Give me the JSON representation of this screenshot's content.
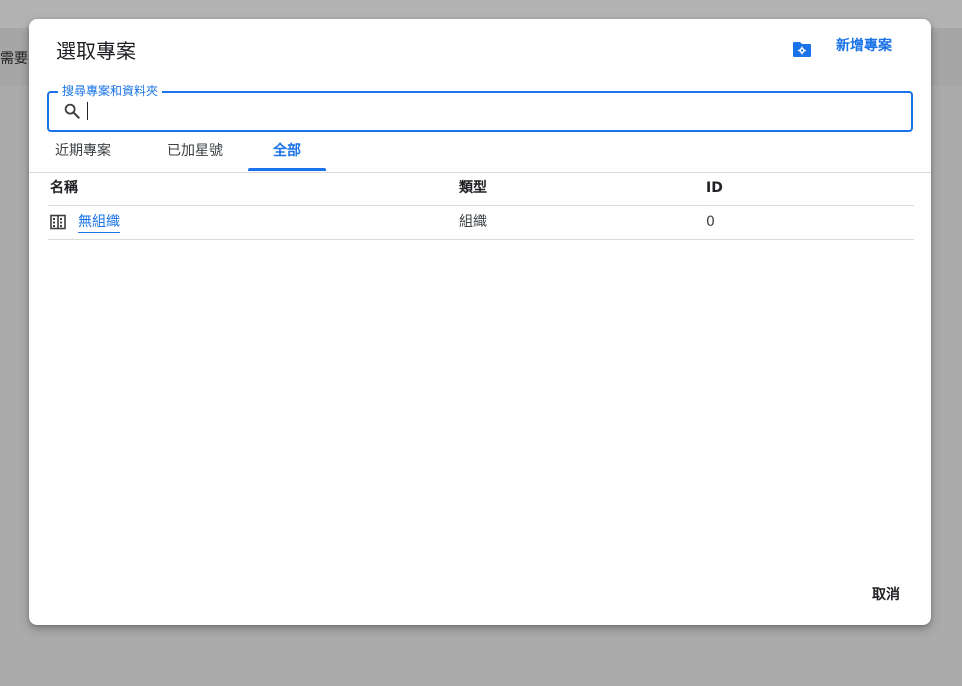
{
  "background": {
    "snippet_text": "需要查"
  },
  "dialog": {
    "title": "選取專案",
    "new_folder_icon": "folder-settings-icon",
    "new_project_label": "新增專案",
    "search": {
      "label": "搜尋專案和資料夾",
      "value": "",
      "icon": "search-icon"
    },
    "tabs": [
      {
        "label": "近期專案",
        "active": false
      },
      {
        "label": "已加星號",
        "active": false
      },
      {
        "label": "全部",
        "active": true
      }
    ],
    "table": {
      "headers": {
        "name": "名稱",
        "type": "類型",
        "id": "ID"
      },
      "rows": [
        {
          "name": "無組織",
          "type": "組織",
          "id": "0",
          "icon": "organization-icon"
        }
      ]
    },
    "cancel_label": "取消"
  },
  "colors": {
    "accent": "#1a73e8",
    "scrim": "#ababab",
    "divider": "#dadce0"
  }
}
